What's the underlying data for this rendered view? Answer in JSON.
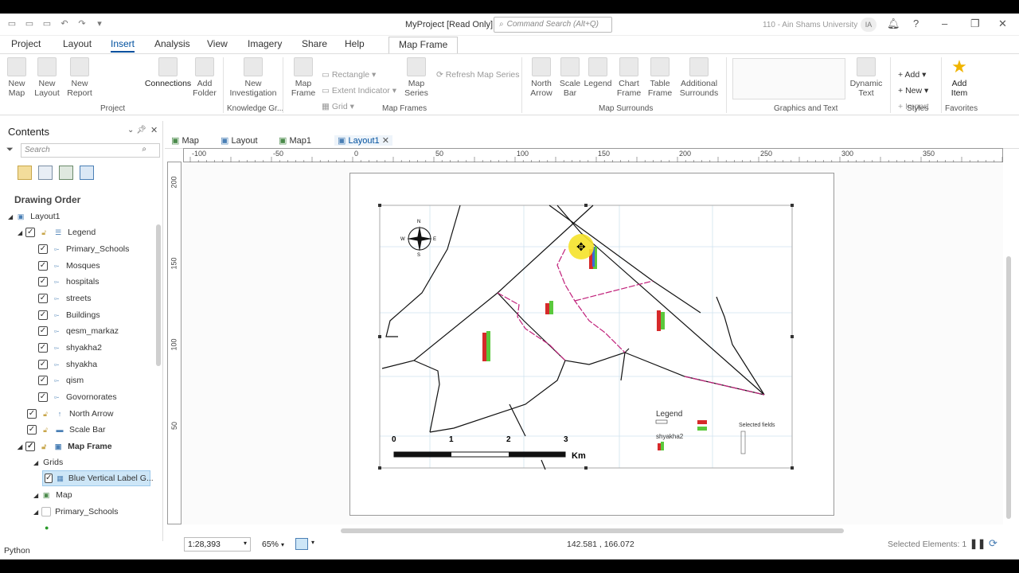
{
  "window": {
    "title": "MyProject [Read Only]",
    "command_search_placeholder": "Command Search (Alt+Q)",
    "user_label": "110 - Ain Shams University",
    "user_initials": "IA"
  },
  "ribbon_tabs": [
    "Project",
    "Layout",
    "Insert",
    "Analysis",
    "View",
    "Imagery",
    "Share",
    "Help"
  ],
  "active_tab": "Insert",
  "contextual_tab": "Map Frame",
  "ribbon": {
    "project": {
      "new_map": "New Map",
      "new_layout": "New Layout",
      "new_report": "New Report",
      "connections": "Connections",
      "add_folder": "Add Folder",
      "group": "Project"
    },
    "knowledge": {
      "new_investigation": "New Investigation",
      "group": "Knowledge Gr..."
    },
    "map_frames": {
      "map_frame": "Map Frame",
      "rectangle": "Rectangle",
      "extent_indicator": "Extent Indicator",
      "grid": "Grid",
      "map_series": "Map Series",
      "refresh_map_series": "Refresh Map Series",
      "group": "Map Frames"
    },
    "map_surrounds": {
      "north_arrow": "North Arrow",
      "scale_bar": "Scale Bar",
      "legend": "Legend",
      "chart_frame": "Chart Frame",
      "table_frame": "Table Frame",
      "additional_surrounds": "Additional Surrounds",
      "group": "Map Surrounds"
    },
    "graphics_text": {
      "dynamic_text": "Dynamic Text",
      "group": "Graphics and Text"
    },
    "styles": {
      "add": "Add",
      "new": "New",
      "import": "Import",
      "group": "Styles"
    },
    "favorites": {
      "add_item": "Add Item",
      "group": "Favorites"
    }
  },
  "contents": {
    "title": "Contents",
    "search_placeholder": "Search",
    "drawing_order": "Drawing Order",
    "items": [
      {
        "label": "Layout1"
      },
      {
        "label": "Legend"
      },
      {
        "label": "Primary_Schools"
      },
      {
        "label": "Mosques"
      },
      {
        "label": "hospitals"
      },
      {
        "label": "streets"
      },
      {
        "label": "Buildings"
      },
      {
        "label": "qesm_markaz"
      },
      {
        "label": "shyakha2"
      },
      {
        "label": "shyakha"
      },
      {
        "label": "qism"
      },
      {
        "label": "Govornorates"
      },
      {
        "label": "North Arrow"
      },
      {
        "label": "Scale Bar"
      },
      {
        "label": "Map Frame"
      },
      {
        "label": "Grids"
      },
      {
        "label": "Blue Vertical Label G..."
      },
      {
        "label": "Map"
      },
      {
        "label": "Primary_Schools"
      }
    ]
  },
  "doc_tabs": [
    "Map",
    "Layout",
    "Map1",
    "Layout1"
  ],
  "ruler": {
    "h_ticks": [
      "-100",
      "-50",
      "0",
      "50",
      "100",
      "150",
      "200",
      "250",
      "300",
      "350"
    ],
    "v_ticks": [
      "200",
      "150",
      "100",
      "50"
    ]
  },
  "map": {
    "scale_labels": [
      "0",
      "1",
      "2",
      "3"
    ],
    "scale_unit": "Km",
    "legend_title": "Legend",
    "legend_layer": "shyakha2",
    "selected_fields": "Selected fields",
    "north_letters": [
      "N",
      "E",
      "S",
      "W"
    ]
  },
  "status": {
    "scale": "1:28,393",
    "zoom": "65%",
    "coords": "142.581 , 166.072",
    "selected": "Selected Elements: 1"
  },
  "python_label": "Python",
  "colors": {
    "accent": "#00509e",
    "selection_bg": "#cde6f7",
    "boundary_pink": "#c0207a"
  }
}
